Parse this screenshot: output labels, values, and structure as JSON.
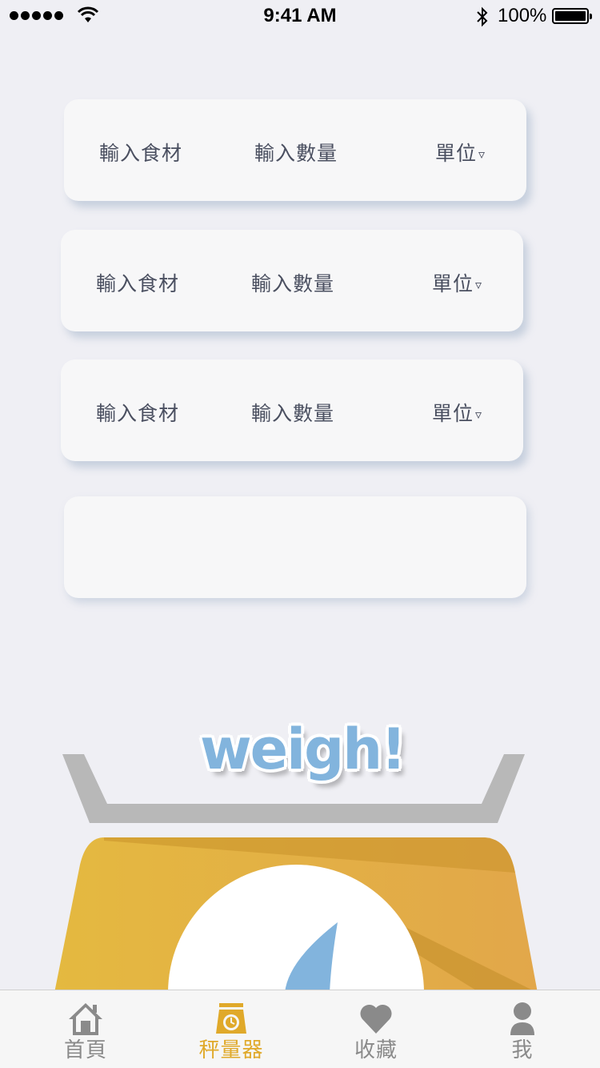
{
  "status_bar": {
    "time": "9:41 AM",
    "battery": "100%"
  },
  "rows": [
    {
      "ingredient_placeholder": "輸入食材",
      "quantity_placeholder": "輸入數量",
      "unit_label": "單位",
      "unit_arrow": "▿"
    },
    {
      "ingredient_placeholder": "輸入食材",
      "quantity_placeholder": "輸入數量",
      "unit_label": "單位",
      "unit_arrow": "▿"
    },
    {
      "ingredient_placeholder": "輸入食材",
      "quantity_placeholder": "輸入數量",
      "unit_label": "單位",
      "unit_arrow": "▿"
    }
  ],
  "weigh_button": "weigh!",
  "tabs": [
    {
      "label": "首頁",
      "icon": "home-icon"
    },
    {
      "label": "秤量器",
      "icon": "scale-icon"
    },
    {
      "label": "收藏",
      "icon": "heart-icon"
    },
    {
      "label": "我",
      "icon": "person-icon"
    }
  ],
  "colors": {
    "accent": "#e0a92a",
    "weigh_text": "#82b4dd",
    "tab_inactive": "#8a8a8a",
    "background": "#efeff4"
  }
}
